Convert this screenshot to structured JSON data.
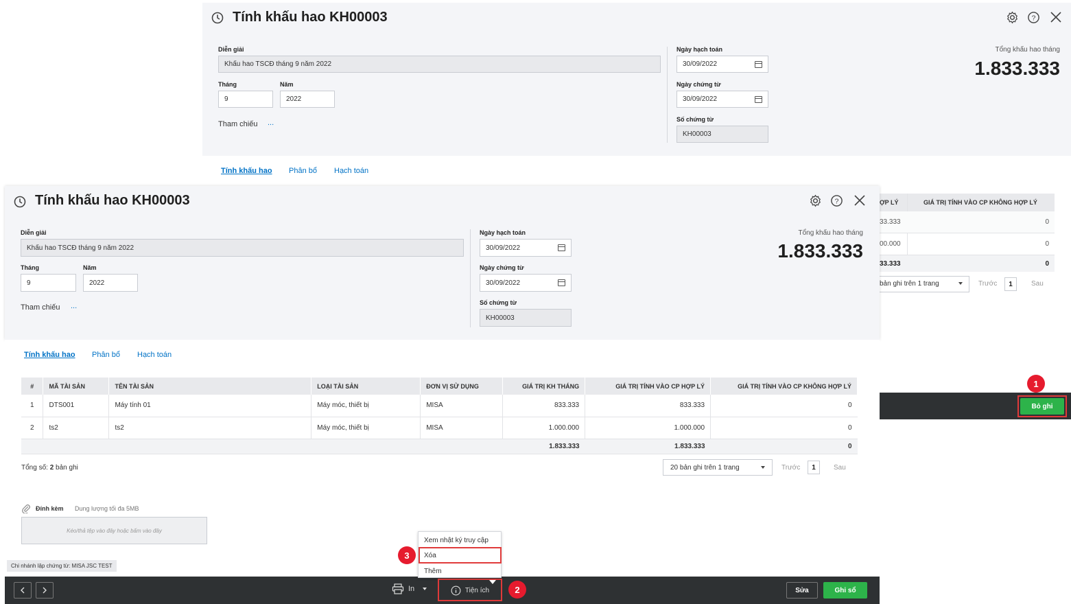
{
  "back_window": {
    "title": "Tính khấu hao KH00003",
    "dien_giai_label": "Diễn giải",
    "dien_giai_value": "Khấu hao TSCĐ tháng 9 năm 2022",
    "thang_label": "Tháng",
    "thang_value": "9",
    "nam_label": "Năm",
    "nam_value": "2022",
    "tham_chieu_label": "Tham chiếu",
    "tham_chieu_more": "...",
    "ngay_hach_toan_label": "Ngày hạch toán",
    "ngay_hach_toan_value": "30/09/2022",
    "ngay_chung_tu_label": "Ngày chứng từ",
    "ngay_chung_tu_value": "30/09/2022",
    "so_chung_tu_label": "Số chứng từ",
    "so_chung_tu_value": "KH00003",
    "total_label": "Tổng khấu hao tháng",
    "total_value": "1.833.333",
    "tabs": [
      "Tính khấu hao",
      "Phân bổ",
      "Hạch toán"
    ],
    "partial_header_1": "ỢP LÝ",
    "partial_header_2": "GIÁ TRỊ TÍNH VÀO CP KHÔNG HỢP LÝ",
    "partial_rows": [
      {
        "a": "33.333",
        "b": "0"
      },
      {
        "a": "00.000",
        "b": "0"
      }
    ],
    "partial_total": {
      "a": "33.333",
      "b": "0"
    },
    "partial_paging": "bản ghi trên 1 trang",
    "partial_prev": "Trước",
    "partial_page": "1",
    "partial_next": "Sau",
    "bo_ghi_label": "Bỏ ghi"
  },
  "front_window": {
    "title": "Tính khấu hao KH00003",
    "dien_giai_label": "Diễn giải",
    "dien_giai_value": "Khấu hao TSCĐ tháng 9 năm 2022",
    "thang_label": "Tháng",
    "thang_value": "9",
    "nam_label": "Năm",
    "nam_value": "2022",
    "tham_chieu_label": "Tham chiếu",
    "tham_chieu_more": "...",
    "ngay_hach_toan_label": "Ngày hạch toán",
    "ngay_hach_toan_value": "30/09/2022",
    "ngay_chung_tu_label": "Ngày chứng từ",
    "ngay_chung_tu_value": "30/09/2022",
    "so_chung_tu_label": "Số chứng từ",
    "so_chung_tu_value": "KH00003",
    "total_label": "Tổng khấu hao tháng",
    "total_value": "1.833.333",
    "tabs": [
      "Tính khấu hao",
      "Phân bổ",
      "Hạch toán"
    ],
    "table": {
      "headers": [
        "#",
        "MÃ TÀI SẢN",
        "TÊN TÀI SẢN",
        "LOẠI TÀI SẢN",
        "ĐƠN VỊ SỬ DỤNG",
        "GIÁ TRỊ KH THÁNG",
        "GIÁ TRỊ TÍNH VÀO CP HỢP LÝ",
        "GIÁ TRỊ TÍNH VÀO CP KHÔNG HỢP LÝ"
      ],
      "rows": [
        {
          "no": "1",
          "ma": "DTS001",
          "ten": "Máy tính 01",
          "loai": "Máy móc, thiết bị",
          "don_vi": "MISA",
          "kh_thang": "833.333",
          "hop_ly": "833.333",
          "khong_hop_ly": "0"
        },
        {
          "no": "2",
          "ma": "ts2",
          "ten": "ts2",
          "loai": "Máy móc, thiết bị",
          "don_vi": "MISA",
          "kh_thang": "1.000.000",
          "hop_ly": "1.000.000",
          "khong_hop_ly": "0"
        }
      ],
      "totals": {
        "kh_thang": "1.833.333",
        "hop_ly": "1.833.333",
        "khong_hop_ly": "0"
      }
    },
    "tong_so_prefix": "Tổng số: ",
    "tong_so_count": "2",
    "tong_so_suffix": " bản ghi",
    "page_size": "20 bản ghi trên 1 trang",
    "prev": "Trước",
    "page": "1",
    "next": "Sau",
    "attach_label": "Đính kèm",
    "attach_limit": "Dung lượng tối đa 5MB",
    "attach_drop": "Kéo/thả tệp vào đây hoặc bấm vào đây",
    "branch": "Chi nhánh lập chứng từ: MISA JSC TEST",
    "menu_items": [
      "Xem nhật ký truy cập",
      "Xóa",
      "Thêm"
    ],
    "print_label": "In",
    "tien_ich_label": "Tiện ích",
    "sua_label": "Sửa",
    "ghi_so_label": "Ghi sổ"
  },
  "badges": [
    "1",
    "2",
    "3"
  ],
  "colors": {
    "accent_green": "#2db34a",
    "link_blue": "#0072c6",
    "badge_red": "#e61b2e",
    "footer_dark": "#2e3133"
  }
}
